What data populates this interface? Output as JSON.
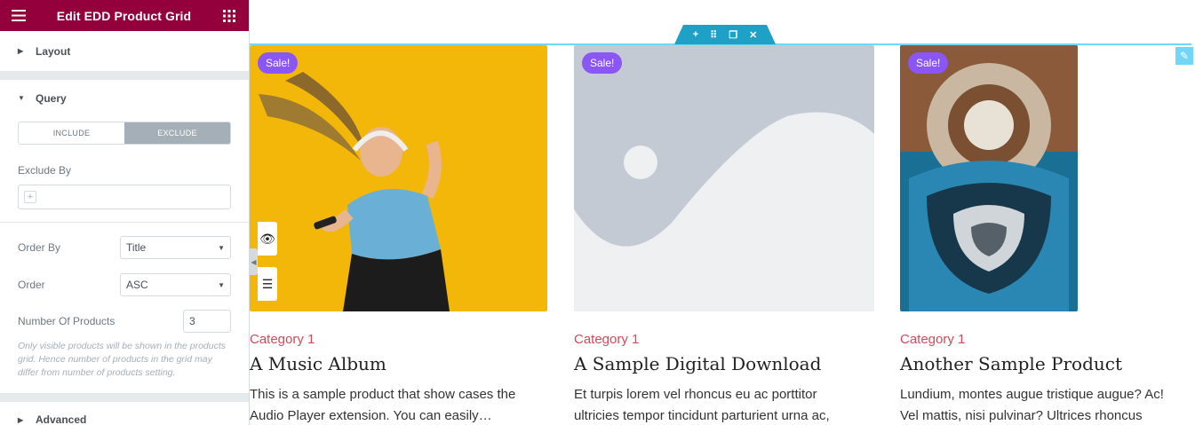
{
  "panel": {
    "title": "Edit EDD Product Grid"
  },
  "sections": {
    "layout": "Layout",
    "query": "Query",
    "advanced": "Advanced"
  },
  "query": {
    "include_label": "INCLUDE",
    "exclude_label": "EXCLUDE",
    "exclude_by_label": "Exclude By",
    "order_by_label": "Order By",
    "order_by_value": "Title",
    "order_label": "Order",
    "order_value": "ASC",
    "num_products_label": "Number Of Products",
    "num_products_value": "3",
    "note": "Only visible products will be shown in the products grid. Hence number of products in the grid may differ from number of products setting."
  },
  "toolbar": {
    "add": "+",
    "move": "⠿",
    "duplicate": "❐",
    "close": "✕"
  },
  "products": [
    {
      "sale": "Sale!",
      "category": "Category 1",
      "title": "A Music Album",
      "desc1": "This is a sample product that show cases the",
      "desc2": "Audio Player extension. You can easily…"
    },
    {
      "sale": "Sale!",
      "category": "Category 1",
      "title": "A Sample Digital Download",
      "desc1": "Et turpis lorem vel rhoncus eu ac porttitor",
      "desc2": "ultricies tempor tincidunt parturient urna ac,"
    },
    {
      "sale": "Sale!",
      "category": "Category 1",
      "title": "Another Sample Product",
      "desc1": "Lundium, montes augue tristique augue? Ac!",
      "desc2": "Vel mattis, nisi pulvinar? Ultrices rhoncus"
    }
  ],
  "colors": {
    "header": "#93003c",
    "sale_badge": "#8a56f5",
    "category": "#d14b5a",
    "selection": "#71d7f7",
    "handle": "#1fa0c6"
  }
}
